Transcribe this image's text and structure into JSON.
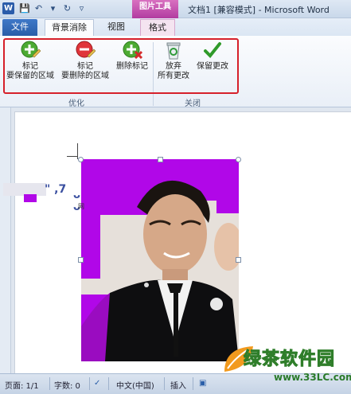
{
  "window": {
    "app_icon": "W",
    "title": "文档1 [兼容模式] - Microsoft Word",
    "context_tab_group": "图片工具"
  },
  "tabs": {
    "file": "文件",
    "background_removal": "背景消除",
    "view": "视图",
    "format": "格式"
  },
  "ribbon": {
    "mark_keep_line1": "标记",
    "mark_keep_line2": "要保留的区域",
    "mark_remove_line1": "标记",
    "mark_remove_line2": "要删除的区域",
    "delete_mark": "删除标记",
    "discard_line1": "放弃",
    "discard_line2": "所有更改",
    "keep_changes": "保留更改",
    "group_optimize": "优化",
    "group_close": "关闭"
  },
  "watermark_left": {
    "text": "\" ,7",
    "text2": "ᴗ ᴗ",
    "small": "网"
  },
  "statusbar": {
    "page": "页面: 1/1",
    "words": "字数: 0",
    "language": "中文(中国)",
    "insert": "插入"
  },
  "logo": {
    "name": "绿茶软件园",
    "url": "www.33LC.com"
  },
  "colors": {
    "file_tab": "#2a5ea8",
    "picture_tools": "#b23ca0",
    "removal_overlay": "#b107e8",
    "highlight_box": "#d6202a"
  }
}
